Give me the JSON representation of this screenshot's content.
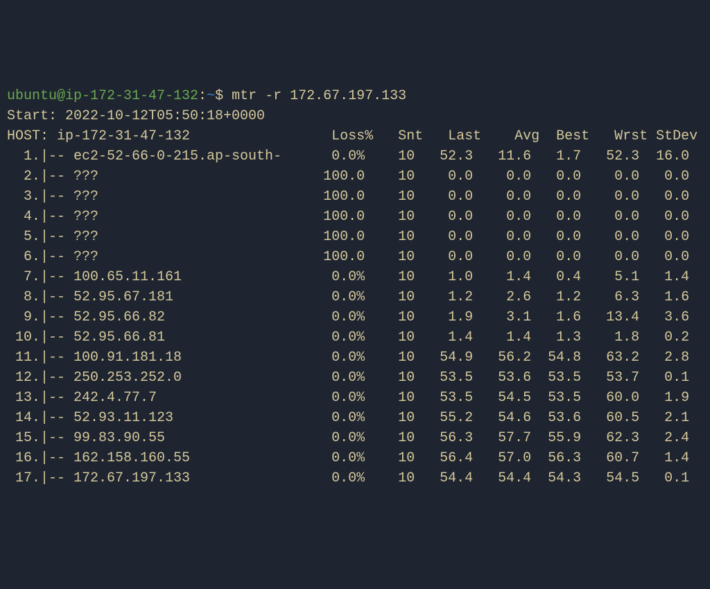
{
  "prompt": {
    "user": "ubuntu@ip-172-31-47-132",
    "colon": ":",
    "path": "~",
    "dollar": "$",
    "command": "mtr -r 172.67.197.133"
  },
  "start_line": "Start: 2022-10-12T05:50:18+0000",
  "host_line": {
    "label": "HOST:",
    "host": "ip-172-31-47-132",
    "cols": [
      "Loss%",
      "Snt",
      "Last",
      "Avg",
      "Best",
      "Wrst",
      "StDev"
    ]
  },
  "hops": [
    {
      "n": "1",
      "host": "ec2-52-66-0-215.ap-south-",
      "loss": "0.0%",
      "snt": "10",
      "last": "52.3",
      "avg": "11.6",
      "best": "1.7",
      "wrst": "52.3",
      "stdev": "16.0"
    },
    {
      "n": "2",
      "host": "???",
      "loss": "100.0",
      "snt": "10",
      "last": "0.0",
      "avg": "0.0",
      "best": "0.0",
      "wrst": "0.0",
      "stdev": "0.0"
    },
    {
      "n": "3",
      "host": "???",
      "loss": "100.0",
      "snt": "10",
      "last": "0.0",
      "avg": "0.0",
      "best": "0.0",
      "wrst": "0.0",
      "stdev": "0.0"
    },
    {
      "n": "4",
      "host": "???",
      "loss": "100.0",
      "snt": "10",
      "last": "0.0",
      "avg": "0.0",
      "best": "0.0",
      "wrst": "0.0",
      "stdev": "0.0"
    },
    {
      "n": "5",
      "host": "???",
      "loss": "100.0",
      "snt": "10",
      "last": "0.0",
      "avg": "0.0",
      "best": "0.0",
      "wrst": "0.0",
      "stdev": "0.0"
    },
    {
      "n": "6",
      "host": "???",
      "loss": "100.0",
      "snt": "10",
      "last": "0.0",
      "avg": "0.0",
      "best": "0.0",
      "wrst": "0.0",
      "stdev": "0.0"
    },
    {
      "n": "7",
      "host": "100.65.11.161",
      "loss": "0.0%",
      "snt": "10",
      "last": "1.0",
      "avg": "1.4",
      "best": "0.4",
      "wrst": "5.1",
      "stdev": "1.4"
    },
    {
      "n": "8",
      "host": "52.95.67.181",
      "loss": "0.0%",
      "snt": "10",
      "last": "1.2",
      "avg": "2.6",
      "best": "1.2",
      "wrst": "6.3",
      "stdev": "1.6"
    },
    {
      "n": "9",
      "host": "52.95.66.82",
      "loss": "0.0%",
      "snt": "10",
      "last": "1.9",
      "avg": "3.1",
      "best": "1.6",
      "wrst": "13.4",
      "stdev": "3.6"
    },
    {
      "n": "10",
      "host": "52.95.66.81",
      "loss": "0.0%",
      "snt": "10",
      "last": "1.4",
      "avg": "1.4",
      "best": "1.3",
      "wrst": "1.8",
      "stdev": "0.2"
    },
    {
      "n": "11",
      "host": "100.91.181.18",
      "loss": "0.0%",
      "snt": "10",
      "last": "54.9",
      "avg": "56.2",
      "best": "54.8",
      "wrst": "63.2",
      "stdev": "2.8"
    },
    {
      "n": "12",
      "host": "250.253.252.0",
      "loss": "0.0%",
      "snt": "10",
      "last": "53.5",
      "avg": "53.6",
      "best": "53.5",
      "wrst": "53.7",
      "stdev": "0.1"
    },
    {
      "n": "13",
      "host": "242.4.77.7",
      "loss": "0.0%",
      "snt": "10",
      "last": "53.5",
      "avg": "54.5",
      "best": "53.5",
      "wrst": "60.0",
      "stdev": "1.9"
    },
    {
      "n": "14",
      "host": "52.93.11.123",
      "loss": "0.0%",
      "snt": "10",
      "last": "55.2",
      "avg": "54.6",
      "best": "53.6",
      "wrst": "60.5",
      "stdev": "2.1"
    },
    {
      "n": "15",
      "host": "99.83.90.55",
      "loss": "0.0%",
      "snt": "10",
      "last": "56.3",
      "avg": "57.7",
      "best": "55.9",
      "wrst": "62.3",
      "stdev": "2.4"
    },
    {
      "n": "16",
      "host": "162.158.160.55",
      "loss": "0.0%",
      "snt": "10",
      "last": "56.4",
      "avg": "57.0",
      "best": "56.3",
      "wrst": "60.7",
      "stdev": "1.4"
    },
    {
      "n": "17",
      "host": "172.67.197.133",
      "loss": "0.0%",
      "snt": "10",
      "last": "54.4",
      "avg": "54.4",
      "best": "54.3",
      "wrst": "54.5",
      "stdev": "0.1"
    }
  ]
}
